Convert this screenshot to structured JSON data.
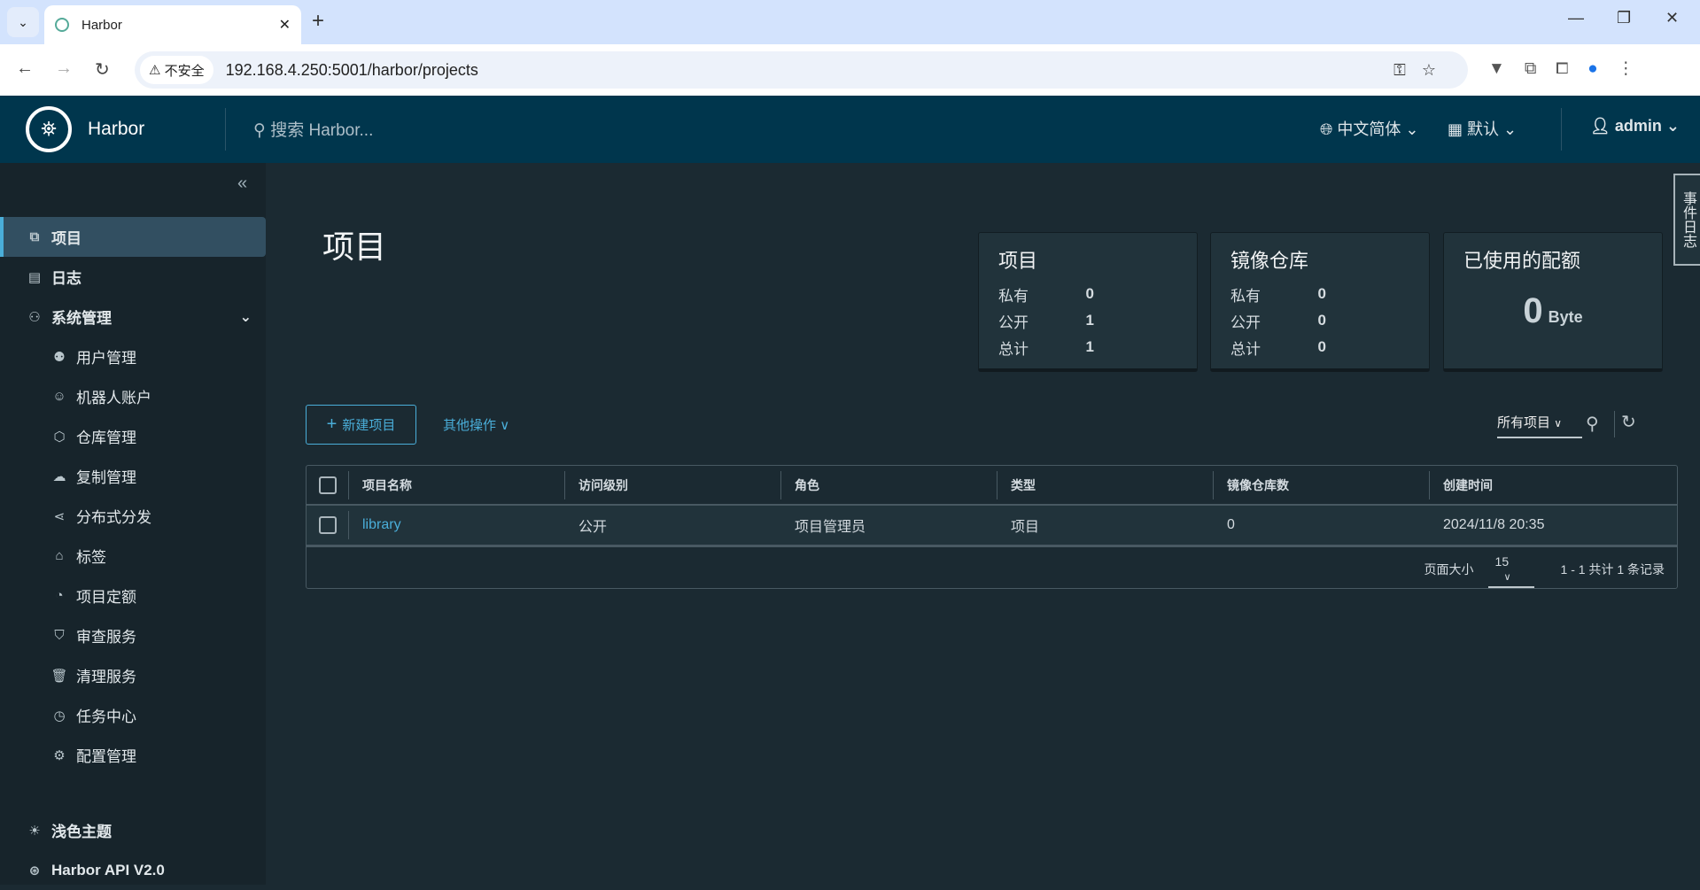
{
  "browser": {
    "tab_title": "Harbor",
    "url": "192.168.4.250:5001/harbor/projects",
    "security_label": "不安全"
  },
  "header": {
    "brand": "Harbor",
    "search_placeholder": "搜索 Harbor...",
    "language": "中文简体",
    "datetime_format": "默认",
    "user": "admin"
  },
  "sidebar": {
    "items": [
      {
        "label": "项目",
        "icon": "projects-icon",
        "active": true
      },
      {
        "label": "日志",
        "icon": "log-icon"
      },
      {
        "label": "系统管理",
        "icon": "admin-icon",
        "expanded": true
      },
      {
        "label": "用户管理",
        "icon": "users-icon"
      },
      {
        "label": "机器人账户",
        "icon": "robot-icon"
      },
      {
        "label": "仓库管理",
        "icon": "registry-icon"
      },
      {
        "label": "复制管理",
        "icon": "replication-icon"
      },
      {
        "label": "分布式分发",
        "icon": "share-icon"
      },
      {
        "label": "标签",
        "icon": "tag-icon"
      },
      {
        "label": "项目定额",
        "icon": "quota-icon"
      },
      {
        "label": "审查服务",
        "icon": "shield-icon"
      },
      {
        "label": "清理服务",
        "icon": "trash-icon"
      },
      {
        "label": "任务中心",
        "icon": "dashboard-icon"
      },
      {
        "label": "配置管理",
        "icon": "gear-icon"
      }
    ],
    "theme": "浅色主题",
    "api": "Harbor API V2.0"
  },
  "page": {
    "title": "项目",
    "event_log": "事件日志"
  },
  "cards": {
    "projects": {
      "title": "项目",
      "rows": [
        {
          "label": "私有",
          "value": "0"
        },
        {
          "label": "公开",
          "value": "1"
        },
        {
          "label": "总计",
          "value": "1"
        }
      ]
    },
    "repos": {
      "title": "镜像仓库",
      "rows": [
        {
          "label": "私有",
          "value": "0"
        },
        {
          "label": "公开",
          "value": "0"
        },
        {
          "label": "总计",
          "value": "0"
        }
      ]
    },
    "quota": {
      "title": "已使用的配额",
      "value": "0",
      "unit": "Byte"
    }
  },
  "toolbar": {
    "new_project": "新建项目",
    "other_actions": "其他操作",
    "filter": "所有项目"
  },
  "table": {
    "columns": [
      "项目名称",
      "访问级别",
      "角色",
      "类型",
      "镜像仓库数",
      "创建时间"
    ],
    "rows": [
      [
        "library",
        "公开",
        "项目管理员",
        "项目",
        "0",
        "2024/11/8 20:35"
      ]
    ],
    "page_size_label": "页面大小",
    "page_size": "15",
    "summary": "1 - 1 共计 1 条记录"
  },
  "colors": {
    "header": "#00364d",
    "accent": "#4aaed9",
    "background": "#1b2a32"
  }
}
